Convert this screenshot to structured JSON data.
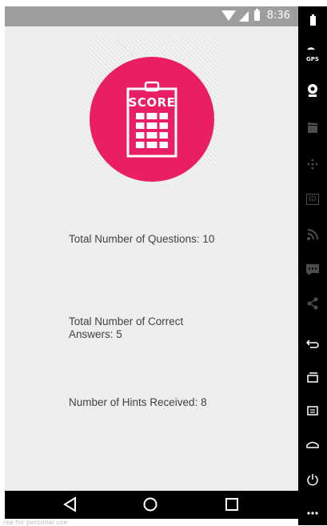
{
  "status_bar": {
    "time": "8:36",
    "wifi_icon": "wifi-icon",
    "signal_icon": "cell-signal-icon",
    "battery_icon": "battery-icon"
  },
  "logo": {
    "text": "SCORE",
    "icon": "scoreboard-clipboard-icon",
    "color": "#e91e63"
  },
  "stats": {
    "questions": "Total Number of Questions: 10",
    "correct": "Total Number of Correct Answers: 5",
    "hints": "Number of Hints Received: 8"
  },
  "nav_bar": {
    "back_icon": "back-triangle-icon",
    "home_icon": "home-circle-icon",
    "recent_icon": "recent-apps-square-icon"
  },
  "emulator_toolbar": {
    "gps_label": "GPS",
    "id_label": "ID",
    "items": [
      "battery-icon",
      "gps-icon",
      "camera-icon",
      "video-clapper-icon",
      "dpad-icon",
      "id-icon",
      "rss-icon",
      "chat-icon",
      "share-icon",
      "back-icon",
      "recent-apps-icon",
      "menu-icon",
      "home-icon",
      "power-icon",
      "more-icon"
    ]
  },
  "watermark": "ree for personal use"
}
